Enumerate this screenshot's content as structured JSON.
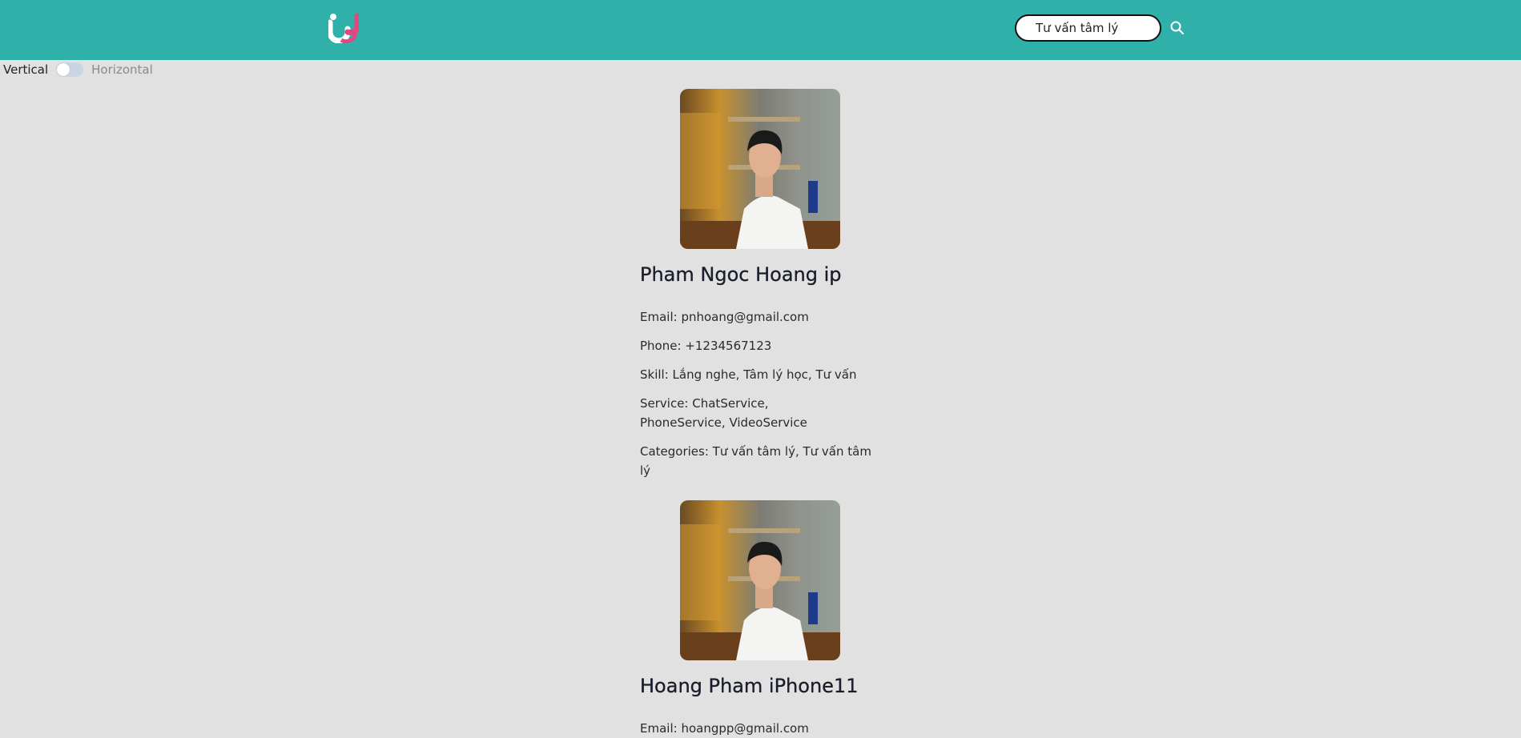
{
  "header": {
    "logo_icon": "u-logo-icon",
    "brand_colors": {
      "bar": "#2fb1aa",
      "logo_white": "#ffffff",
      "logo_pink": "#e8457f"
    }
  },
  "search": {
    "value": "Tư vấn tâm lý",
    "icon": "search-icon"
  },
  "layout_toggle": {
    "left_label": "Vertical",
    "right_label": "Horizontal",
    "state": "Vertical"
  },
  "profiles": [
    {
      "name": "Pham Ngoc Hoang ip",
      "email": "Email: pnhoang@gmail.com",
      "phone": "Phone: +1234567123",
      "skill": "Skill: Lắng nghe, Tâm lý học, Tư vấn",
      "service": "Service: ChatService, PhoneService, VideoService",
      "categories": "Categories: Tư vấn tâm lý, Tư vấn tâm lý"
    },
    {
      "name": "Hoang Pham iPhone11",
      "email": "Email: hoangpp@gmail.com"
    }
  ]
}
